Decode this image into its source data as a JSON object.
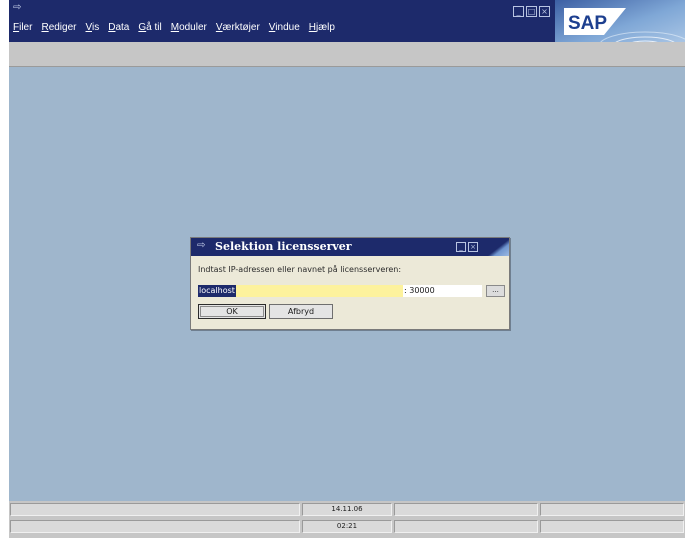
{
  "menu": {
    "items": [
      "Filer",
      "Rediger",
      "Vis",
      "Data",
      "Gå til",
      "Moduler",
      "Værktøjer",
      "Vindue",
      "Hjælp"
    ]
  },
  "brand": {
    "logo_text": "SAP"
  },
  "dialog": {
    "title": "Selektion licensserver",
    "prompt": "Indtast IP-adressen eller navnet på licensserveren:",
    "host_value": "localhost",
    "port_value": ": 30000",
    "browse_label": "...",
    "ok_label": "OK",
    "cancel_label": "Afbryd"
  },
  "status": {
    "date": "14.11.06",
    "time": "02:21"
  },
  "colors": {
    "titlebar": "#1d2a6b",
    "desktop": "#9fb6cc",
    "input_highlight": "#fdf29d"
  },
  "icons": {
    "app": "app-window-icon",
    "dialog": "dialog-icon"
  }
}
